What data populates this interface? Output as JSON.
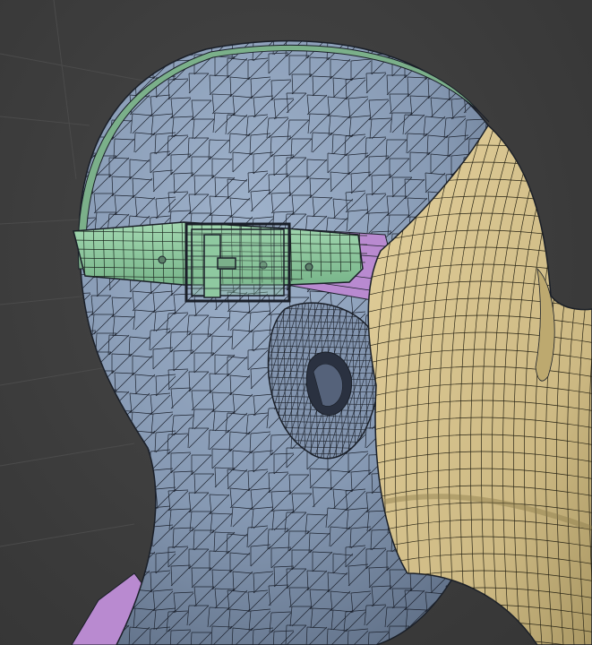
{
  "viewport": {
    "background_color": "#3d3d3d",
    "grid_color": "#4a4a4a"
  },
  "objects": [
    {
      "name": "head",
      "color": "#8ea2bd",
      "display": "wireframe-overlay",
      "mesh": "triangulated"
    },
    {
      "name": "strap",
      "color": "#8fc9a0",
      "display": "wireframe-overlay",
      "mesh": "quad"
    },
    {
      "name": "buckle",
      "color": "#8fc9a0",
      "display": "wireframe-overlay",
      "mesh": "quad"
    },
    {
      "name": "strap-underlayer",
      "color": "#b98ad0",
      "display": "wireframe-overlay",
      "mesh": "quad"
    },
    {
      "name": "mask",
      "color": "#d9c48f",
      "display": "wireframe-overlay",
      "mesh": "quad"
    },
    {
      "name": "ear",
      "color": "#8ea2bd",
      "display": "wireframe-overlay",
      "mesh": "triangulated-dense"
    }
  ],
  "wire_color": "#1a1f28"
}
